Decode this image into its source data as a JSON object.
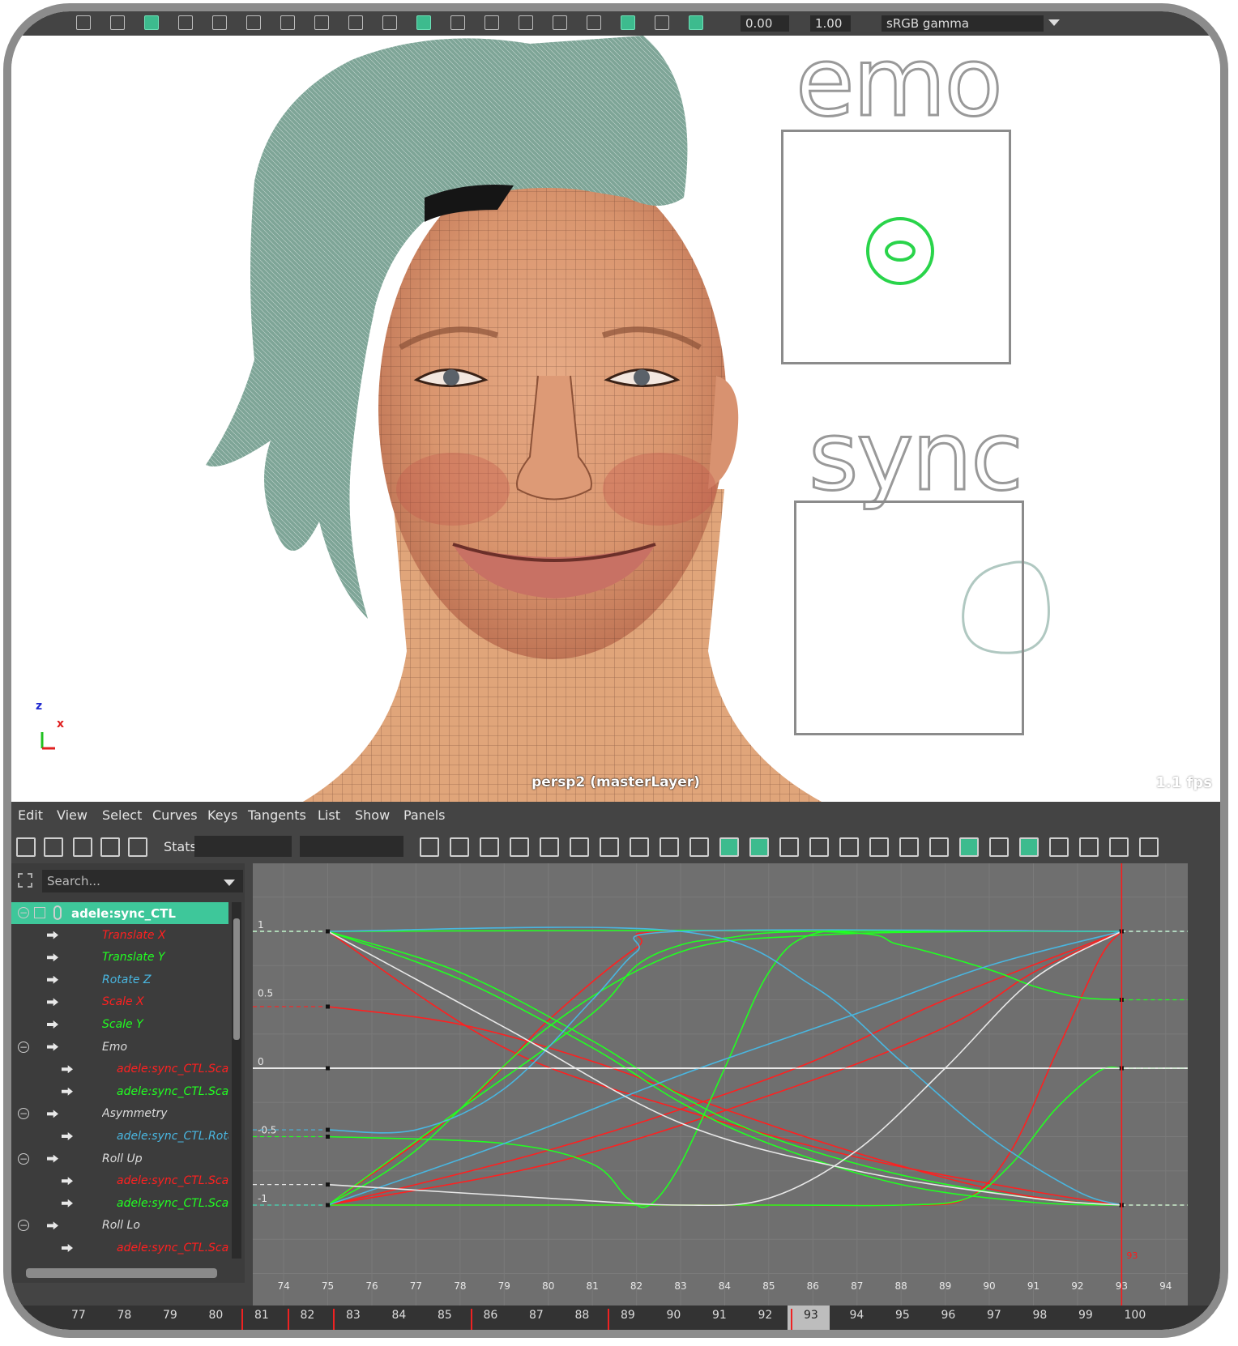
{
  "toolbar": {
    "exposure_value": "0.00",
    "gamma_value": "1.00",
    "colorspace": "sRGB gamma",
    "icons": [
      "select-icon",
      "bookmark-icon",
      "camera-icon",
      "tumble-icon",
      "grid-icon",
      "film-gate-icon",
      "resolution-gate-icon",
      "field-chart-icon",
      "safe-action-icon",
      "wireframe-icon",
      "smooth-shade-icon",
      "textured-icon",
      "lighting-icon",
      "shadows-icon",
      "isolate-icon",
      "xray-icon",
      "exposure-icon",
      "gamma-icon",
      "color-management-icon"
    ]
  },
  "viewport": {
    "label": "persp2 (masterLayer)",
    "fps": "1.1 fps",
    "axis_z": "z",
    "axis_x": "x",
    "control_emo_label": "emo",
    "control_sync_label": "sync"
  },
  "graph_editor": {
    "menus": [
      "Edit",
      "View",
      "Select",
      "Curves",
      "Keys",
      "Tangents",
      "List",
      "Show",
      "Panels"
    ],
    "stats_label": "Stats",
    "search_placeholder": "Search...",
    "outliner": [
      {
        "label": "adele:sync_CTL",
        "color": "#ffffff",
        "indent": 0,
        "selected": true,
        "collapse": true,
        "expand": true
      },
      {
        "label": "Translate X",
        "color": "#ff2020",
        "indent": 1
      },
      {
        "label": "Translate Y",
        "color": "#21ff21",
        "indent": 1
      },
      {
        "label": "Rotate Z",
        "color": "#49b6e0",
        "indent": 1
      },
      {
        "label": "Scale X",
        "color": "#ff2020",
        "indent": 1
      },
      {
        "label": "Scale Y",
        "color": "#21ff21",
        "indent": 1
      },
      {
        "label": "Emo",
        "color": "#dddddd",
        "indent": 1,
        "collapse": true
      },
      {
        "label": "adele:sync_CTL.Scale X",
        "color": "#ff2020",
        "indent": 2
      },
      {
        "label": "adele:sync_CTL.Scale Y",
        "color": "#21ff21",
        "indent": 2
      },
      {
        "label": "Asymmetry",
        "color": "#dddddd",
        "indent": 1,
        "collapse": true
      },
      {
        "label": "adele:sync_CTL.Rotate Z",
        "color": "#49b6e0",
        "indent": 2
      },
      {
        "label": "Roll Up",
        "color": "#dddddd",
        "indent": 1,
        "collapse": true
      },
      {
        "label": "adele:sync_CTL.Scale X",
        "color": "#ff2020",
        "indent": 2
      },
      {
        "label": "adele:sync_CTL.Scale Y",
        "color": "#21ff21",
        "indent": 2
      },
      {
        "label": "Roll Lo",
        "color": "#dddddd",
        "indent": 1,
        "collapse": true
      },
      {
        "label": "adele:sync_CTL.Scale X",
        "color": "#ff2020",
        "indent": 2
      }
    ],
    "y_ticks": [
      "1",
      "0.5",
      "0",
      "-0.5",
      "-1"
    ],
    "x_ticks": [
      "74",
      "75",
      "76",
      "77",
      "78",
      "79",
      "80",
      "81",
      "82",
      "83",
      "84",
      "85",
      "86",
      "87",
      "88",
      "89",
      "90",
      "91",
      "92",
      "93",
      "94"
    ],
    "current_frame_label": "93"
  },
  "chart_data": {
    "type": "line",
    "x_range": [
      73.3,
      94.5
    ],
    "y_range": [
      -1.5,
      1.5
    ],
    "current_frame": 93,
    "series": [
      {
        "color": "#ff2020",
        "x": [
          75,
          79,
          83,
          87,
          91,
          93
        ],
        "y": [
          1,
          0.15,
          -0.3,
          -0.65,
          -0.9,
          -1
        ]
      },
      {
        "color": "#ff2020",
        "x": [
          75,
          78,
          80,
          82,
          83,
          93
        ],
        "y": [
          -1,
          -0.3,
          0.35,
          0.88,
          1,
          1
        ]
      },
      {
        "color": "#ff2020",
        "x": [
          75,
          77,
          80,
          83,
          86,
          89,
          93
        ],
        "y": [
          -1,
          -0.85,
          -0.6,
          -0.3,
          0.05,
          0.5,
          1
        ]
      },
      {
        "color": "#ff2020",
        "x": [
          75,
          80,
          85,
          89,
          91,
          93
        ],
        "y": [
          -1,
          -0.7,
          -0.2,
          0.3,
          0.7,
          1
        ]
      },
      {
        "color": "#ff2020",
        "x": [
          75,
          78,
          81,
          84,
          87,
          90,
          92,
          93
        ],
        "y": [
          0.45,
          0.32,
          0.05,
          -0.3,
          -0.62,
          -0.88,
          -0.98,
          -1
        ]
      },
      {
        "color": "#ff2020",
        "x": [
          75,
          82,
          85,
          88,
          89.5,
          90.5,
          91.5,
          92.5,
          93
        ],
        "y": [
          -1,
          -1,
          -1,
          -1,
          -0.95,
          -0.6,
          0.1,
          0.8,
          1
        ]
      },
      {
        "color": "#21ff21",
        "x": [
          75,
          78,
          81,
          83,
          85,
          88,
          91,
          93
        ],
        "y": [
          1,
          0.7,
          0.2,
          -0.2,
          -0.5,
          -0.78,
          -0.95,
          -1
        ]
      },
      {
        "color": "#21ff21",
        "x": [
          75,
          78,
          81,
          83,
          85,
          88,
          91,
          93
        ],
        "y": [
          1,
          0.65,
          0.15,
          -0.25,
          -0.55,
          -0.85,
          -0.98,
          -1
        ]
      },
      {
        "color": "#21ff21",
        "x": [
          75,
          77,
          80,
          83,
          86,
          90,
          93
        ],
        "y": [
          -1,
          -0.6,
          0.3,
          0.85,
          0.97,
          1,
          1
        ]
      },
      {
        "color": "#21ff21",
        "x": [
          75,
          78,
          81,
          82,
          83,
          84,
          86,
          93
        ],
        "y": [
          -1,
          -0.3,
          0.4,
          0.75,
          0.9,
          0.95,
          1,
          1
        ]
      },
      {
        "color": "#21ff21",
        "x": [
          75,
          79,
          81,
          81.8,
          82.3,
          83,
          84,
          85,
          86,
          88,
          93
        ],
        "y": [
          -0.5,
          -0.55,
          -0.7,
          -0.95,
          -1,
          -0.7,
          0,
          0.7,
          0.98,
          1,
          1
        ]
      },
      {
        "color": "#21ff21",
        "x": [
          75,
          86,
          88,
          90,
          91,
          92,
          93
        ],
        "y": [
          1,
          1,
          0.9,
          0.72,
          0.6,
          0.52,
          0.5
        ]
      },
      {
        "color": "#21ff21",
        "x": [
          75,
          85,
          88,
          89.5,
          90.5,
          91.5,
          92.5,
          93
        ],
        "y": [
          -1,
          -1,
          -1,
          -0.95,
          -0.7,
          -0.3,
          -0.02,
          0
        ]
      },
      {
        "color": "#49b6e0",
        "x": [
          75,
          77,
          79,
          81,
          82,
          83,
          93
        ],
        "y": [
          -0.45,
          -0.45,
          -0.15,
          0.5,
          0.85,
          1,
          1
        ]
      },
      {
        "color": "#49b6e0",
        "x": [
          75,
          79,
          83,
          87,
          90,
          93
        ],
        "y": [
          -1,
          -0.55,
          -0.05,
          0.4,
          0.75,
          1
        ]
      },
      {
        "color": "#49b6e0",
        "x": [
          75,
          83,
          86,
          88,
          90,
          92,
          93
        ],
        "y": [
          1,
          1,
          0.6,
          0.05,
          -0.5,
          -0.9,
          -1
        ]
      },
      {
        "color": "#e8e8e8",
        "x": [
          75,
          79,
          83,
          87,
          91,
          93
        ],
        "y": [
          1,
          0.3,
          -0.4,
          -0.75,
          -0.95,
          -1
        ]
      },
      {
        "color": "#e8e8e8",
        "x": [
          75,
          80,
          83,
          85,
          87,
          89,
          91,
          93
        ],
        "y": [
          -0.85,
          -0.95,
          -1,
          -0.95,
          -0.6,
          0,
          0.65,
          1
        ]
      },
      {
        "color": "#e8e8e8",
        "x": [
          75,
          93
        ],
        "y": [
          0,
          0
        ]
      }
    ]
  },
  "timeline": {
    "frames": [
      "77",
      "78",
      "79",
      "80",
      "81",
      "82",
      "83",
      "84",
      "85",
      "86",
      "87",
      "88",
      "89",
      "90",
      "91",
      "92",
      "93",
      "94",
      "95",
      "96",
      "97",
      "98",
      "99",
      "100"
    ],
    "key_frames": [
      "81",
      "82",
      "83",
      "86",
      "89",
      "93"
    ],
    "current": "93"
  }
}
